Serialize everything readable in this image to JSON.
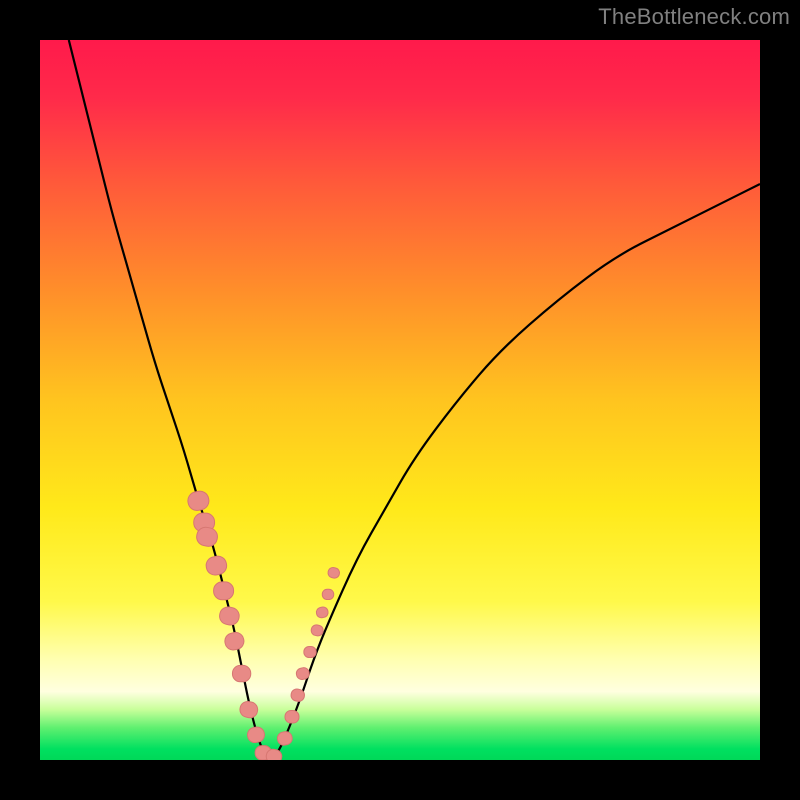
{
  "watermark": "TheBottleneck.com",
  "colors": {
    "black": "#000000",
    "gradient_stops": [
      {
        "offset": 0.0,
        "color": "#ff1a4b"
      },
      {
        "offset": 0.08,
        "color": "#ff2a4a"
      },
      {
        "offset": 0.2,
        "color": "#ff5a3a"
      },
      {
        "offset": 0.35,
        "color": "#ff8f2a"
      },
      {
        "offset": 0.5,
        "color": "#ffc41f"
      },
      {
        "offset": 0.65,
        "color": "#ffe91a"
      },
      {
        "offset": 0.78,
        "color": "#fff94a"
      },
      {
        "offset": 0.86,
        "color": "#ffffb0"
      },
      {
        "offset": 0.905,
        "color": "#ffffe0"
      },
      {
        "offset": 0.93,
        "color": "#c8ff9a"
      },
      {
        "offset": 0.955,
        "color": "#60f070"
      },
      {
        "offset": 0.985,
        "color": "#00e060"
      },
      {
        "offset": 1.0,
        "color": "#00d858"
      }
    ],
    "marker_fill": "#e88a86",
    "marker_stroke": "#d77772",
    "curve": "#000000"
  },
  "chart_data": {
    "type": "line",
    "title": "",
    "xlabel": "",
    "ylabel": "",
    "xlim": [
      0,
      100
    ],
    "ylim": [
      0,
      100
    ],
    "series": [
      {
        "name": "bottleneck-curve",
        "x": [
          4,
          6,
          8,
          10,
          12,
          14,
          16,
          18,
          20,
          22,
          24,
          26,
          27,
          28,
          29,
          30,
          31,
          32,
          33,
          34,
          36,
          38,
          40,
          44,
          48,
          52,
          58,
          64,
          72,
          80,
          88,
          96,
          100
        ],
        "y": [
          100,
          92,
          84,
          76,
          69,
          62,
          55,
          49,
          43,
          36,
          30,
          22,
          18,
          13,
          8,
          4,
          1,
          0,
          1,
          3,
          8,
          14,
          19,
          28,
          35,
          42,
          50,
          57,
          64,
          70,
          74,
          78,
          80
        ]
      }
    ],
    "markers": {
      "name": "highlighted-points",
      "x": [
        22.0,
        22.8,
        23.2,
        24.5,
        25.5,
        26.3,
        27.0,
        28.0,
        29.0,
        30.0,
        31.0,
        32.5,
        34.0,
        35.0,
        35.8,
        36.5,
        37.5,
        38.5,
        39.2,
        40.0,
        40.8
      ],
      "y": [
        36,
        33,
        31,
        27,
        23.5,
        20,
        16.5,
        12,
        7,
        3.5,
        1,
        0.5,
        3,
        6,
        9,
        12,
        15,
        18,
        20.5,
        23,
        26
      ]
    }
  }
}
